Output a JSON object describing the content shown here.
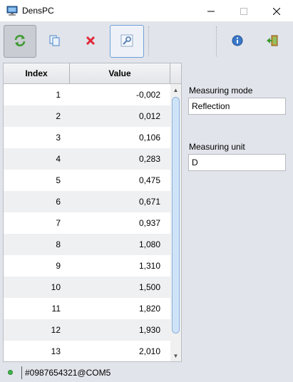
{
  "window": {
    "title": "DensPC",
    "minimize_glyph": "—",
    "maximize_glyph": "☐",
    "close_glyph": "✕"
  },
  "toolbar": {
    "buttons": [
      {
        "name": "refresh",
        "icon": "refresh-icon"
      },
      {
        "name": "copy",
        "icon": "copy-icon"
      },
      {
        "name": "delete",
        "icon": "delete-icon"
      },
      {
        "name": "settings",
        "icon": "settings-icon"
      },
      {
        "name": "info",
        "icon": "info-icon"
      },
      {
        "name": "exit",
        "icon": "exit-icon"
      }
    ]
  },
  "table": {
    "headers": [
      "Index",
      "Value"
    ],
    "rows": [
      {
        "index": "1",
        "value": "-0,002"
      },
      {
        "index": "2",
        "value": "0,012"
      },
      {
        "index": "3",
        "value": "0,106"
      },
      {
        "index": "4",
        "value": "0,283"
      },
      {
        "index": "5",
        "value": "0,475"
      },
      {
        "index": "6",
        "value": "0,671"
      },
      {
        "index": "7",
        "value": "0,937"
      },
      {
        "index": "8",
        "value": "1,080"
      },
      {
        "index": "9",
        "value": "1,310"
      },
      {
        "index": "10",
        "value": "1,500"
      },
      {
        "index": "11",
        "value": "1,820"
      },
      {
        "index": "12",
        "value": "1,930"
      },
      {
        "index": "13",
        "value": "2,010"
      }
    ]
  },
  "settings": {
    "mode_label": "Measuring mode",
    "mode_value": "Reflection",
    "unit_label": "Measuring unit",
    "unit_value": "D"
  },
  "status": {
    "text": "#0987654321@COM5",
    "indicator_color": "#3fb24b"
  }
}
